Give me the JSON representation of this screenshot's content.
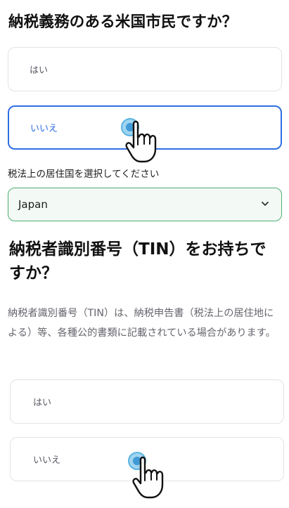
{
  "question1": {
    "title": "納税義務のある米国市民ですか？",
    "options": [
      {
        "label": "はい",
        "selected": false
      },
      {
        "label": "いいえ",
        "selected": true
      }
    ]
  },
  "residence": {
    "label": "税法上の居住国を選択してください",
    "selected_value": "Japan",
    "icon": "chevron-down-icon"
  },
  "question2": {
    "title": "納税者識別番号（TIN）をお持ちですか？",
    "description": "納税者識別番号（TIN）は、納税申告書（税法上の居住地による）等、各種公的書類に記載されている場合があります。",
    "options": [
      {
        "label": "はい",
        "selected": false
      },
      {
        "label": "いいえ",
        "selected": false
      }
    ]
  },
  "colors": {
    "accent_blue": "#2f6fe4",
    "select_border_green": "#4caf72",
    "select_bg": "#f3f9f4",
    "tap_indicator": "#5ab4e0"
  }
}
